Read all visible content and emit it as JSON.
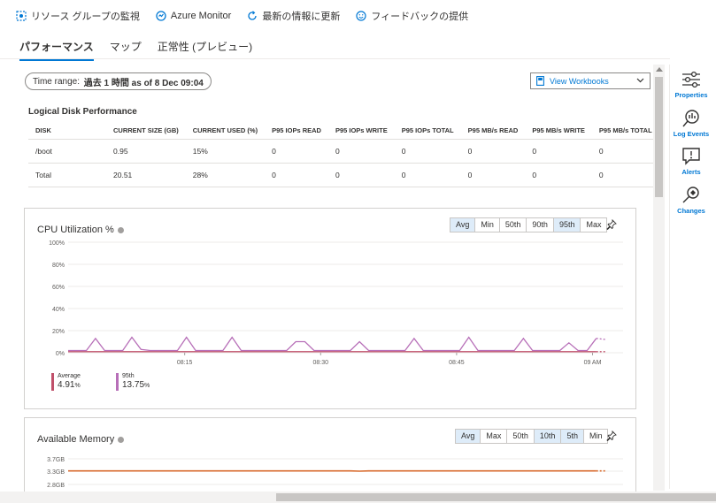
{
  "toolbar": {
    "items": [
      {
        "label": "リソース グループの監視",
        "icon": "monitor-resource-icon"
      },
      {
        "label": "Azure Monitor",
        "icon": "azure-monitor-icon"
      },
      {
        "label": "最新の情報に更新",
        "icon": "refresh-icon"
      },
      {
        "label": "フィードバックの提供",
        "icon": "smiley-icon"
      }
    ]
  },
  "tabs": [
    {
      "label": "パフォーマンス",
      "active": true
    },
    {
      "label": "マップ",
      "active": false
    },
    {
      "label": "正常性 (プレビュー)",
      "active": false
    }
  ],
  "time_range": {
    "prefix": "Time range:",
    "value": "過去 1 時間 as of 8 Dec 09:04"
  },
  "workbooks": {
    "label": "View Workbooks"
  },
  "disk": {
    "title": "Logical Disk Performance",
    "columns": [
      "DISK",
      "CURRENT SIZE (GB)",
      "CURRENT USED (%)",
      "P95 IOPs READ",
      "P95 IOPs WRITE",
      "P95 IOPs TOTAL",
      "P95 MB/s READ",
      "P95 MB/s WRITE",
      "P95 MB/s TOTAL"
    ],
    "rows": [
      [
        "/boot",
        "0.95",
        "15%",
        "0",
        "0",
        "0",
        "0",
        "0",
        "0"
      ],
      [
        "Total",
        "20.51",
        "28%",
        "0",
        "0",
        "0",
        "0",
        "0",
        "0"
      ]
    ]
  },
  "cpu": {
    "title": "CPU Utilization %",
    "buttons": [
      {
        "label": "Avg",
        "selected": true
      },
      {
        "label": "Min",
        "selected": false
      },
      {
        "label": "50th",
        "selected": false
      },
      {
        "label": "90th",
        "selected": false
      },
      {
        "label": "95th",
        "selected": true
      },
      {
        "label": "Max",
        "selected": false
      }
    ],
    "legend": [
      {
        "name": "Average",
        "value": "4.91",
        "unit": "%",
        "color": "#c0506a"
      },
      {
        "name": "95th",
        "value": "13.75",
        "unit": "%",
        "color": "#b76fb8"
      }
    ]
  },
  "memory": {
    "title": "Available Memory",
    "buttons": [
      {
        "label": "Avg",
        "selected": true
      },
      {
        "label": "Max",
        "selected": false
      },
      {
        "label": "50th",
        "selected": false
      },
      {
        "label": "10th",
        "selected": true
      },
      {
        "label": "5th",
        "selected": true
      },
      {
        "label": "Min",
        "selected": false
      }
    ]
  },
  "sidebar": [
    {
      "label": "Properties",
      "icon": "properties-icon"
    },
    {
      "label": "Log Events",
      "icon": "log-events-icon"
    },
    {
      "label": "Alerts",
      "icon": "alerts-icon"
    },
    {
      "label": "Changes",
      "icon": "changes-icon"
    }
  ],
  "chart_data": [
    {
      "type": "line",
      "title": "CPU Utilization %",
      "ylim": [
        0,
        100
      ],
      "y_ticks": [
        "100%",
        "80%",
        "60%",
        "40%",
        "20%",
        "0%"
      ],
      "x_ticks": [
        "08:15",
        "08:30",
        "08:45",
        "09 AM"
      ],
      "series": [
        {
          "name": "Average",
          "color": "#c0506a",
          "values": [
            1,
            1,
            1,
            1,
            1,
            1,
            1,
            1,
            1,
            1,
            1,
            1,
            1,
            1,
            1,
            1,
            1,
            1,
            1,
            1,
            1,
            1,
            1,
            1,
            1,
            1,
            1,
            1,
            1,
            1,
            1,
            1,
            1,
            1,
            1,
            1,
            1,
            1,
            1,
            1,
            1,
            1,
            1,
            1,
            1,
            1,
            1,
            1,
            1,
            1,
            1,
            1,
            1,
            1,
            1,
            1,
            1,
            1,
            1,
            1
          ]
        },
        {
          "name": "95th",
          "color": "#b76fb8",
          "values": [
            2,
            2,
            2,
            13,
            2,
            2,
            2,
            14,
            3,
            2,
            2,
            2,
            2,
            14,
            2,
            2,
            2,
            2,
            14,
            2,
            2,
            2,
            2,
            2,
            2,
            10,
            10,
            2,
            2,
            2,
            2,
            2,
            10,
            2,
            2,
            2,
            2,
            2,
            13,
            2,
            2,
            2,
            2,
            2,
            14,
            2,
            2,
            2,
            2,
            2,
            13,
            2,
            2,
            2,
            2,
            9,
            2,
            2,
            13,
            12
          ]
        }
      ]
    },
    {
      "type": "line",
      "title": "Available Memory",
      "y_ticks": [
        "3.7GB",
        "3.3GB",
        "2.8GB"
      ],
      "series": [
        {
          "name": "Average",
          "color": "#d86a2c",
          "values": [
            3.31,
            3.31,
            3.31,
            3.31,
            3.31,
            3.31,
            3.31,
            3.31,
            3.31,
            3.31,
            3.31,
            3.31,
            3.31,
            3.31,
            3.31,
            3.31,
            3.31,
            3.31,
            3.31,
            3.31,
            3.31,
            3.31,
            3.31,
            3.31,
            3.31,
            3.31,
            3.31,
            3.31,
            3.31,
            3.31,
            3.31,
            3.31,
            3.3,
            3.31,
            3.31,
            3.31,
            3.31,
            3.31,
            3.31,
            3.31,
            3.31,
            3.31,
            3.31,
            3.31,
            3.31,
            3.31,
            3.31,
            3.31,
            3.31,
            3.31,
            3.31,
            3.31,
            3.31,
            3.31,
            3.31,
            3.31,
            3.31,
            3.31,
            3.31,
            3.31
          ]
        }
      ]
    }
  ]
}
